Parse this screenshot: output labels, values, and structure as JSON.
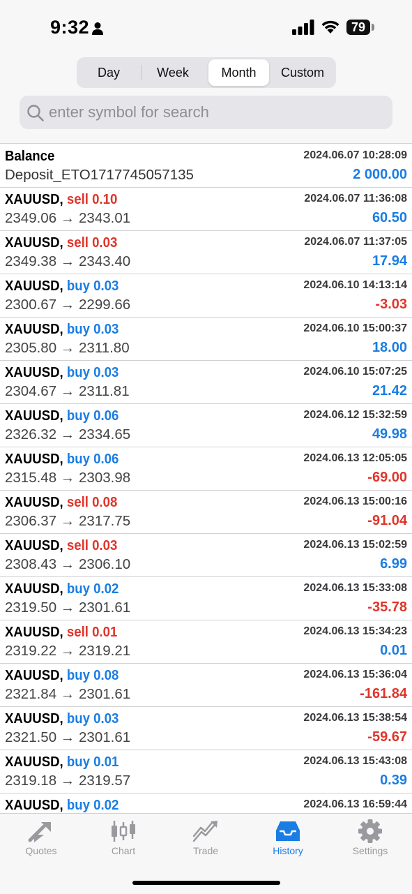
{
  "status_bar": {
    "time": "9:32",
    "battery": "79"
  },
  "period_tabs": [
    "Day",
    "Week",
    "Month",
    "Custom"
  ],
  "active_period": "Month",
  "search": {
    "placeholder": "enter symbol for search",
    "value": ""
  },
  "balance": {
    "title": "Balance",
    "comment": "Deposit_ETO1717745057135",
    "datetime": "2024.06.07 10:28:09",
    "amount": "2 000.00"
  },
  "trades": [
    {
      "symbol": "XAUUSD,",
      "side": "sell",
      "volume": "0.10",
      "open": "2349.06",
      "close": "2343.01",
      "datetime": "2024.06.07 11:36:08",
      "profit": "60.50"
    },
    {
      "symbol": "XAUUSD,",
      "side": "sell",
      "volume": "0.03",
      "open": "2349.38",
      "close": "2343.40",
      "datetime": "2024.06.07 11:37:05",
      "profit": "17.94"
    },
    {
      "symbol": "XAUUSD,",
      "side": "buy",
      "volume": "0.03",
      "open": "2300.67",
      "close": "2299.66",
      "datetime": "2024.06.10 14:13:14",
      "profit": "-3.03"
    },
    {
      "symbol": "XAUUSD,",
      "side": "buy",
      "volume": "0.03",
      "open": "2305.80",
      "close": "2311.80",
      "datetime": "2024.06.10 15:00:37",
      "profit": "18.00"
    },
    {
      "symbol": "XAUUSD,",
      "side": "buy",
      "volume": "0.03",
      "open": "2304.67",
      "close": "2311.81",
      "datetime": "2024.06.10 15:07:25",
      "profit": "21.42"
    },
    {
      "symbol": "XAUUSD,",
      "side": "buy",
      "volume": "0.06",
      "open": "2326.32",
      "close": "2334.65",
      "datetime": "2024.06.12 15:32:59",
      "profit": "49.98"
    },
    {
      "symbol": "XAUUSD,",
      "side": "buy",
      "volume": "0.06",
      "open": "2315.48",
      "close": "2303.98",
      "datetime": "2024.06.13 12:05:05",
      "profit": "-69.00"
    },
    {
      "symbol": "XAUUSD,",
      "side": "sell",
      "volume": "0.08",
      "open": "2306.37",
      "close": "2317.75",
      "datetime": "2024.06.13 15:00:16",
      "profit": "-91.04"
    },
    {
      "symbol": "XAUUSD,",
      "side": "sell",
      "volume": "0.03",
      "open": "2308.43",
      "close": "2306.10",
      "datetime": "2024.06.13 15:02:59",
      "profit": "6.99"
    },
    {
      "symbol": "XAUUSD,",
      "side": "buy",
      "volume": "0.02",
      "open": "2319.50",
      "close": "2301.61",
      "datetime": "2024.06.13 15:33:08",
      "profit": "-35.78"
    },
    {
      "symbol": "XAUUSD,",
      "side": "sell",
      "volume": "0.01",
      "open": "2319.22",
      "close": "2319.21",
      "datetime": "2024.06.13 15:34:23",
      "profit": "0.01"
    },
    {
      "symbol": "XAUUSD,",
      "side": "buy",
      "volume": "0.08",
      "open": "2321.84",
      "close": "2301.61",
      "datetime": "2024.06.13 15:36:04",
      "profit": "-161.84"
    },
    {
      "symbol": "XAUUSD,",
      "side": "buy",
      "volume": "0.03",
      "open": "2321.50",
      "close": "2301.61",
      "datetime": "2024.06.13 15:38:54",
      "profit": "-59.67"
    },
    {
      "symbol": "XAUUSD,",
      "side": "buy",
      "volume": "0.01",
      "open": "2319.18",
      "close": "2319.57",
      "datetime": "2024.06.13 15:43:08",
      "profit": "0.39"
    },
    {
      "symbol": "XAUUSD,",
      "side": "buy",
      "volume": "0.02",
      "open": "",
      "close": "",
      "datetime": "2024.06.13 16:59:44",
      "profit": ""
    }
  ],
  "tab_bar": [
    {
      "label": "Quotes",
      "icon": "quotes-icon"
    },
    {
      "label": "Chart",
      "icon": "chart-icon"
    },
    {
      "label": "Trade",
      "icon": "trade-icon"
    },
    {
      "label": "History",
      "icon": "history-icon"
    },
    {
      "label": "Settings",
      "icon": "gear-icon"
    }
  ],
  "active_tab": "History",
  "colors": {
    "accent": "#1a7de3",
    "sell": "#e0352b",
    "inactive": "#9a9a9e"
  }
}
